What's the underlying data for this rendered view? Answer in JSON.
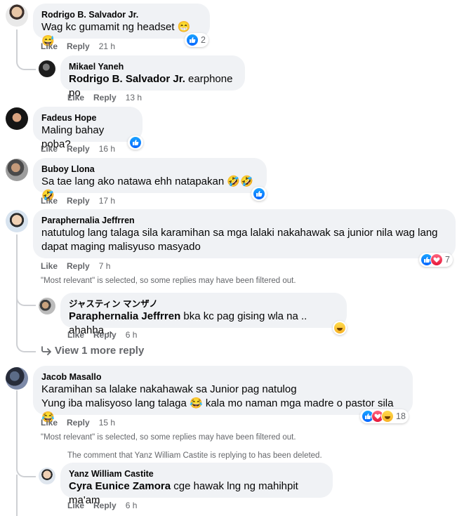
{
  "comments": {
    "c1": {
      "author": "Rodrigo B. Salvador Jr.",
      "text": "Wag kc gumamit ng headset",
      "emoji": "😁😅",
      "actions": {
        "like": "Like",
        "reply": "Reply",
        "time": "21 h"
      },
      "reactions": {
        "count": "2",
        "types": [
          "like"
        ]
      }
    },
    "c1r1": {
      "author": "Mikael Yaneh",
      "mention": "Rodrigo B. Salvador Jr.",
      "text": " earphone po",
      "actions": {
        "like": "Like",
        "reply": "Reply",
        "time": "13 h"
      }
    },
    "c2": {
      "author": "Fadeus Hope",
      "text": "Maling bahay poba?",
      "actions": {
        "like": "Like",
        "reply": "Reply",
        "time": "16 h"
      },
      "reactions": {
        "count": "",
        "types": [
          "like"
        ]
      }
    },
    "c3": {
      "author": "Buboy Llona",
      "text": "Sa tae lang ako natawa ehh natapakan",
      "emoji": "🤣🤣🤣",
      "actions": {
        "like": "Like",
        "reply": "Reply",
        "time": "17 h"
      },
      "reactions": {
        "count": "",
        "types": [
          "like"
        ]
      }
    },
    "c4": {
      "author": "Paraphernalia Jeffrren",
      "text": "natutulog lang talaga sila karamihan sa mga lalaki nakahawak sa junior nila wag lang dapat maging malisyuso masyado",
      "actions": {
        "like": "Like",
        "reply": "Reply",
        "time": "7 h"
      },
      "reactions": {
        "count": "7",
        "types": [
          "like",
          "love"
        ]
      }
    },
    "c4note": "\"Most relevant\" is selected, so some replies may have been filtered out.",
    "c4r1": {
      "author": "ジャスティン マンザノ",
      "mention": "Paraphernalia Jeffrren",
      "text": " bka kc pag gising wla na .. ahahha ..",
      "actions": {
        "like": "Like",
        "reply": "Reply",
        "time": "6 h"
      },
      "reactions": {
        "count": "",
        "types": [
          "haha"
        ]
      }
    },
    "c4more": "View 1 more reply",
    "c5": {
      "author": "Jacob Masallo",
      "line1": "Karamihan sa lalake nakahawak sa Junior pag natulog",
      "line2a": "Yung iba malisyoso lang talaga ",
      "emoji1": "😂",
      "line2b": " kala mo naman mga madre o pastor sila ",
      "emoji2": "😂",
      "actions": {
        "like": "Like",
        "reply": "Reply",
        "time": "15 h"
      },
      "reactions": {
        "count": "18",
        "types": [
          "like",
          "love",
          "haha"
        ]
      }
    },
    "c5note": "\"Most relevant\" is selected, so some replies may have been filtered out.",
    "c5deleted": "The comment that Yanz William Castite is replying to has been deleted.",
    "c5r1": {
      "author": "Yanz William Castite",
      "mention": "Cyra Eunice Zamora",
      "text": " cge hawak lng ng mahihpit ma'am",
      "actions": {
        "like": "Like",
        "reply": "Reply",
        "time": "6 h"
      }
    }
  },
  "colors": {
    "like": "#0866ff",
    "love": "#e61739",
    "haha": "#f7b125",
    "bubble": "#f0f2f5",
    "meta": "#65676b"
  }
}
